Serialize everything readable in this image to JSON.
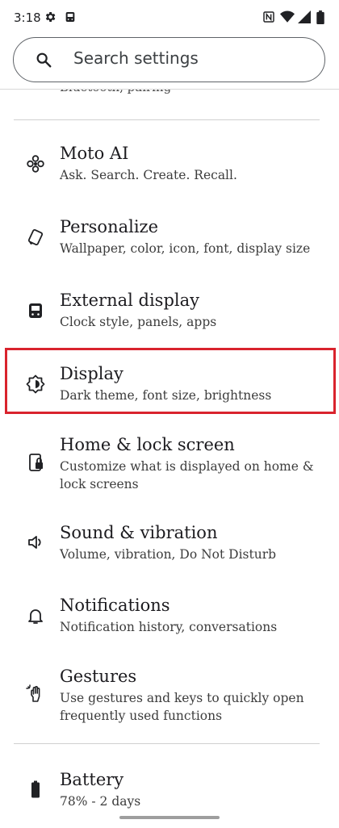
{
  "status_bar": {
    "time": "3:18",
    "icons": [
      "gear-icon",
      "cast-icon",
      "nfc-icon",
      "wifi-icon",
      "signal-icon",
      "battery-icon"
    ]
  },
  "search": {
    "placeholder": "Search settings"
  },
  "previous_item": {
    "subtitle": "Bluetooth, pairing"
  },
  "settings": [
    {
      "title": "Moto AI",
      "subtitle": "Ask. Search. Create. Recall.",
      "icon": "moto-ai-icon"
    },
    {
      "title": "Personalize",
      "subtitle": "Wallpaper, color, icon, font, display size",
      "icon": "personalize-icon"
    },
    {
      "title": "External display",
      "subtitle": "Clock style, panels, apps",
      "icon": "external-display-icon"
    },
    {
      "title": "Display",
      "subtitle": "Dark theme, font size, brightness",
      "icon": "display-brightness-icon"
    },
    {
      "title": "Home & lock screen",
      "subtitle": "Customize what is displayed on home & lock screens",
      "icon": "home-lock-screen-icon"
    },
    {
      "title": "Sound & vibration",
      "subtitle": "Volume, vibration, Do Not Disturb",
      "icon": "speaker-icon"
    },
    {
      "title": "Notifications",
      "subtitle": "Notification history, conversations",
      "icon": "bell-icon"
    },
    {
      "title": "Gestures",
      "subtitle": "Use gestures and keys to quickly open frequently used functions",
      "icon": "gesture-hand-icon"
    },
    {
      "title": "Battery",
      "subtitle": "78% - 2 days",
      "icon": "battery-icon"
    }
  ],
  "colors": {
    "highlight": "#d9232d",
    "text": "#1c1b1f",
    "divider": "#d0d0d0"
  }
}
